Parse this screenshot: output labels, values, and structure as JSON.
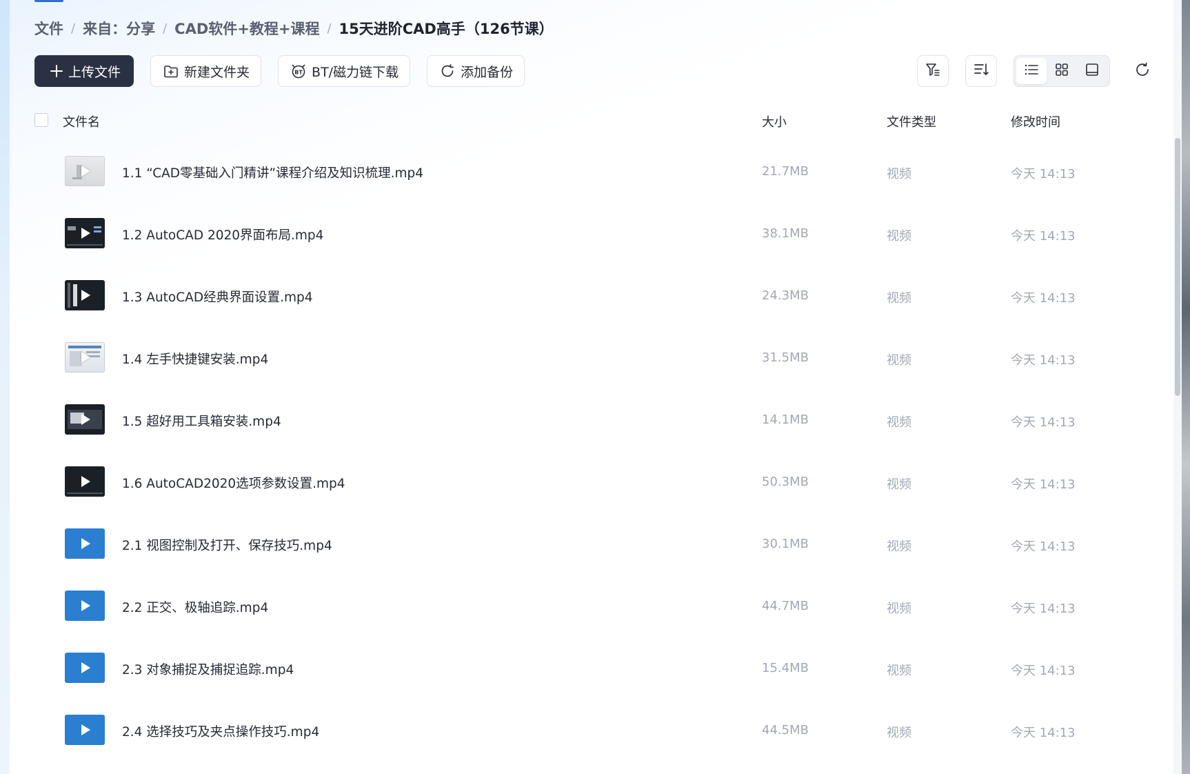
{
  "breadcrumb": {
    "items": [
      "文件",
      "来自：分享",
      "CAD软件+教程+课程",
      "15天进阶CAD高手（126节课）"
    ],
    "separator": "/"
  },
  "toolbar": {
    "upload_label": "上传文件",
    "new_folder_label": "新建文件夹",
    "bt_download_label": "BT/磁力链下载",
    "add_backup_label": "添加备份",
    "right_icons": [
      "filter-icon",
      "sort-icon",
      "list-view-icon",
      "grid-view-icon",
      "preview-view-icon",
      "refresh-icon"
    ]
  },
  "table": {
    "columns": {
      "name": "文件名",
      "size": "大小",
      "type": "文件类型",
      "modified": "修改时间"
    },
    "rows": [
      {
        "name": "1.1 “CAD零基础入门精讲”课程介绍及知识梳理.mp4",
        "size": "21.7MB",
        "type": "视频",
        "modified": "今天 14:13",
        "thumb": "light"
      },
      {
        "name": "1.2 AutoCAD 2020界面布局.mp4",
        "size": "38.1MB",
        "type": "视频",
        "modified": "今天 14:13",
        "thumb": "dark"
      },
      {
        "name": "1.3 AutoCAD经典界面设置.mp4",
        "size": "24.3MB",
        "type": "视频",
        "modified": "今天 14:13",
        "thumb": "dark"
      },
      {
        "name": "1.4 左手快捷键安装.mp4",
        "size": "31.5MB",
        "type": "视频",
        "modified": "今天 14:13",
        "thumb": "screen"
      },
      {
        "name": "1.5 超好用工具箱安装.mp4",
        "size": "14.1MB",
        "type": "视频",
        "modified": "今天 14:13",
        "thumb": "dark"
      },
      {
        "name": "1.6 AutoCAD2020选项参数设置.mp4",
        "size": "50.3MB",
        "type": "视频",
        "modified": "今天 14:13",
        "thumb": "dark"
      },
      {
        "name": "2.1 视图控制及打开、保存技巧.mp4",
        "size": "30.1MB",
        "type": "视频",
        "modified": "今天 14:13",
        "thumb": "blue"
      },
      {
        "name": "2.2 正交、极轴追踪.mp4",
        "size": "44.7MB",
        "type": "视频",
        "modified": "今天 14:13",
        "thumb": "blue"
      },
      {
        "name": "2.3 对象捕捉及捕捉追踪.mp4",
        "size": "15.4MB",
        "type": "视频",
        "modified": "今天 14:13",
        "thumb": "blue"
      },
      {
        "name": "2.4 选择技巧及夹点操作技巧.mp4",
        "size": "44.5MB",
        "type": "视频",
        "modified": "今天 14:13",
        "thumb": "blue"
      }
    ]
  },
  "colors": {
    "primary_button": "#2a3142",
    "video_thumb_blue": "#2b7fd0",
    "muted_text": "#a3a8b2"
  }
}
